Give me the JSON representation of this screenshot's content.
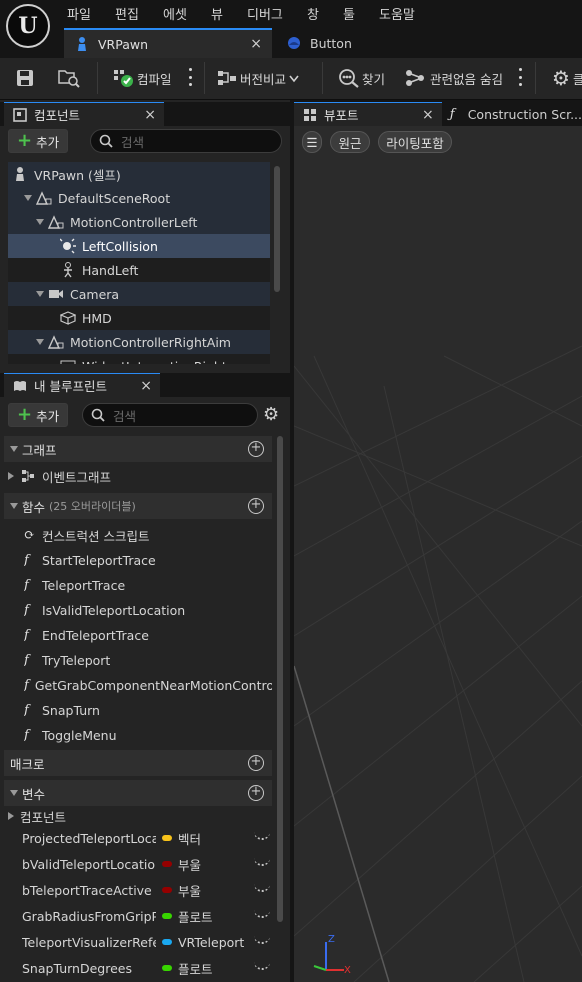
{
  "menubar": {
    "items": [
      "파일",
      "편집",
      "에셋",
      "뷰",
      "디버그",
      "창",
      "툴",
      "도움말"
    ]
  },
  "logo": {
    "text": "U"
  },
  "tabs": [
    {
      "label": "VRPawn",
      "icon": "pawn-icon",
      "active": true,
      "close": "×"
    },
    {
      "label": "Button",
      "icon": "blueprint-icon"
    }
  ],
  "toolbar": {
    "compile_label": "컴파일",
    "diff_label": "버전비교",
    "find_label": "찾기",
    "hide_unrelated_label": "관련없음 숨김",
    "settings_partial": "클"
  },
  "components": {
    "title": "컴포넌트",
    "close": "×",
    "add_label": "추가",
    "add_symbol": "+",
    "search_placeholder": "검색",
    "tree": [
      {
        "label": "VRPawn (셀프)",
        "icon": "pawn-icon",
        "indent": 0,
        "expand": "none"
      },
      {
        "label": "DefaultSceneRoot",
        "icon": "scene-component-icon",
        "indent": 1,
        "expand": "down"
      },
      {
        "label": "MotionControllerLeft",
        "icon": "motion-controller-icon",
        "indent": 2,
        "expand": "down"
      },
      {
        "label": "LeftCollision",
        "icon": "sphere-collision-icon",
        "indent": 3,
        "expand": "none",
        "selected": true
      },
      {
        "label": "HandLeft",
        "icon": "skeletal-mesh-icon",
        "indent": 3,
        "expand": "none"
      },
      {
        "label": "Camera",
        "icon": "camera-icon",
        "indent": 2,
        "expand": "down"
      },
      {
        "label": "HMD",
        "icon": "static-mesh-icon",
        "indent": 3,
        "expand": "none"
      },
      {
        "label": "MotionControllerRightAim",
        "icon": "motion-controller-icon",
        "indent": 2,
        "expand": "down"
      },
      {
        "label": "WidgetInteractionRight",
        "icon": "widget-interaction-icon",
        "indent": 3,
        "expand": "none"
      }
    ]
  },
  "myblueprint": {
    "title": "내 블루프린트",
    "close": "×",
    "add_label": "추가",
    "add_symbol": "+",
    "search_placeholder": "검색",
    "sections": {
      "graph": "그래프",
      "functions": "함수",
      "functions_note": "(25 오버라이더블)",
      "macros": "매크로",
      "variables": "변수"
    },
    "graphs": [
      "이벤트그래프"
    ],
    "functions": [
      "컨스트럭션 스크립트",
      "StartTeleportTrace",
      "TeleportTrace",
      "IsValidTeleportLocation",
      "EndTeleportTrace",
      "TryTeleport",
      "GetGrabComponentNearMotionController",
      "SnapTurn",
      "ToggleMenu"
    ],
    "variable_category": "컴포넌트",
    "variables": [
      {
        "name": "ProjectedTeleportLocation",
        "type": "벡터",
        "color": "#f7c21a"
      },
      {
        "name": "bValidTeleportLocation",
        "type": "부울",
        "color": "#950000"
      },
      {
        "name": "bTeleportTraceActive",
        "type": "부울",
        "color": "#950000"
      },
      {
        "name": "GrabRadiusFromGripPosition",
        "type": "플로트",
        "color": "#38d500"
      },
      {
        "name": "TeleportVisualizerReference",
        "type": "VRTeleport",
        "color": "#1aa8f0"
      },
      {
        "name": "SnapTurnDegrees",
        "type": "플로트",
        "color": "#38d500"
      }
    ]
  },
  "viewport": {
    "title": "뷰포트",
    "close": "×",
    "construction_tab": "Construction Scr...",
    "perspective": "원근",
    "lit": "라이팅포함",
    "menu_symbol": "☰",
    "axis_x": "X",
    "axis_z": "Z"
  }
}
